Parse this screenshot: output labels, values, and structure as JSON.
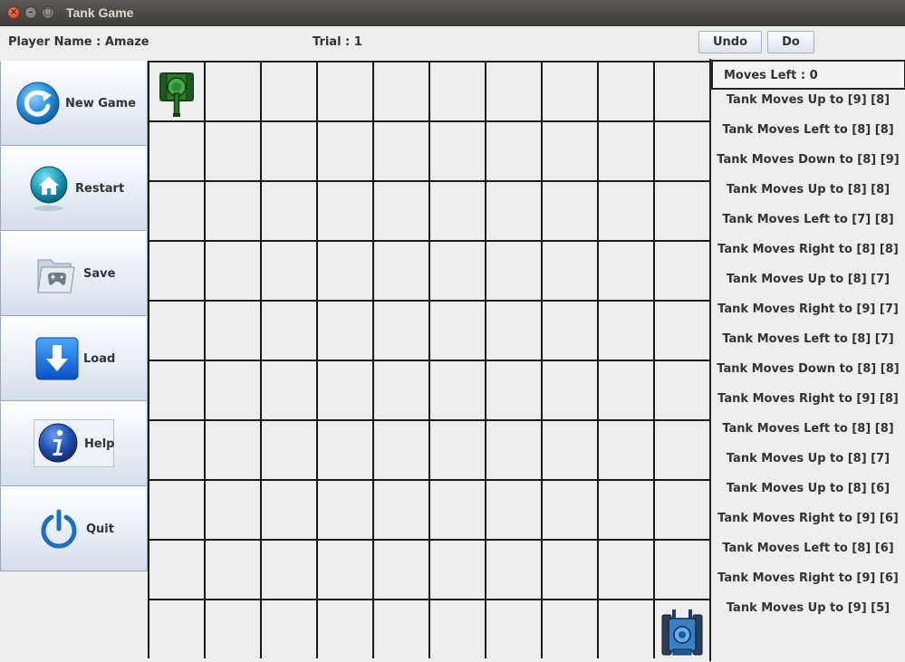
{
  "window": {
    "title": "Tank Game"
  },
  "info": {
    "player_name": "Player Name : Amaze",
    "trial": "Trial : 1"
  },
  "toolbar": {
    "undo_label": "Undo",
    "do_label": "Do"
  },
  "sidebar": {
    "items": [
      {
        "label": "New Game",
        "icon": "refresh-icon"
      },
      {
        "label": "Restart",
        "icon": "home-icon"
      },
      {
        "label": "Save",
        "icon": "folder-gamepad-icon"
      },
      {
        "label": "Load",
        "icon": "download-arrow-icon"
      },
      {
        "label": "Help",
        "icon": "info-icon"
      },
      {
        "label": "Quit",
        "icon": "power-icon"
      }
    ]
  },
  "board": {
    "rows": 10,
    "cols": 10,
    "pieces": [
      {
        "name": "green-tank",
        "icon": "green-tank-icon",
        "row": 0,
        "col": 0
      },
      {
        "name": "blue-tank",
        "icon": "blue-tank-icon",
        "row": 9,
        "col": 9
      }
    ]
  },
  "moves": {
    "moves_left": "Moves Left : 0",
    "history": [
      "Tank Moves Up to [9] [8]",
      "Tank Moves Left to [8] [8]",
      "Tank Moves Down to [8] [9]",
      "Tank Moves Up to [8] [8]",
      "Tank Moves Left to [7] [8]",
      "Tank Moves Right to [8] [8]",
      "Tank Moves Up to [8] [7]",
      "Tank Moves Right to [9] [7]",
      "Tank Moves Left to [8] [7]",
      "Tank Moves Down to [8] [8]",
      "Tank Moves Right to [9] [8]",
      "Tank Moves Left to [8] [8]",
      "Tank Moves Up to [8] [7]",
      "Tank Moves Up to [8] [6]",
      "Tank Moves Right to [9] [6]",
      "Tank Moves Left to [8] [6]",
      "Tank Moves Right to [9] [6]",
      "Tank Moves Up to [9] [5]"
    ]
  },
  "colors": {
    "titlebar": "#3e3d39",
    "close": "#e2532b",
    "button_gradient_bottom": "#d3deeb"
  }
}
